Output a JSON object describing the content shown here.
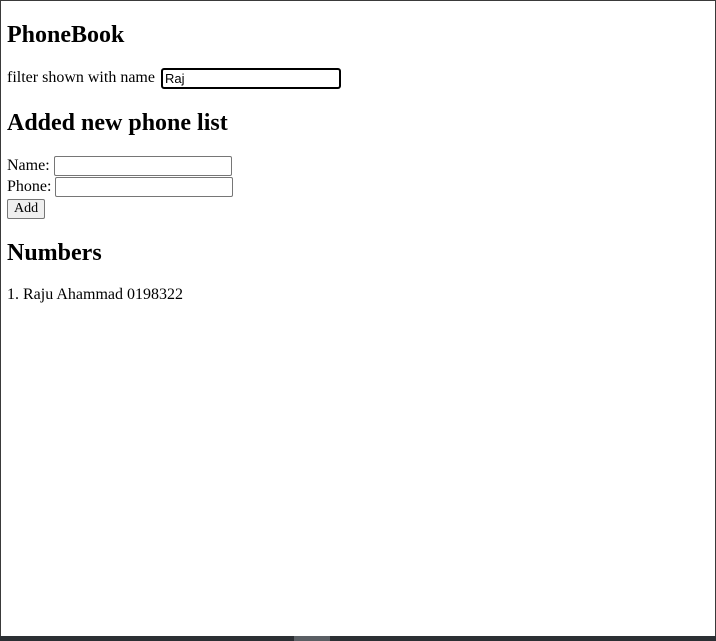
{
  "app": {
    "title": "PhoneBook"
  },
  "filter": {
    "label": "filter shown with name",
    "value": "Raj"
  },
  "add_section": {
    "heading": "Added new phone list",
    "name_label": "Name:",
    "name_value": "",
    "phone_label": "Phone:",
    "phone_value": "",
    "add_button_label": "Add"
  },
  "numbers": {
    "heading": "Numbers",
    "items": [
      {
        "text": "1. Raju Ahammad 0198322"
      }
    ]
  }
}
